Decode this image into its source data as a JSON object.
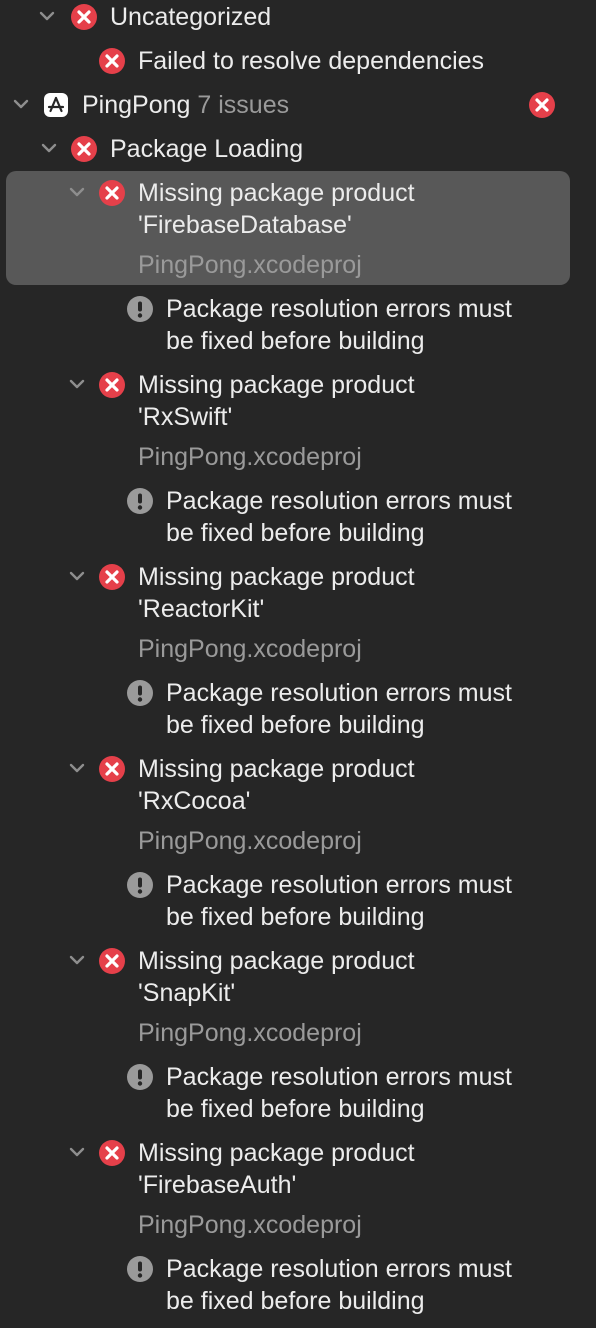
{
  "issues": {
    "uncategorized": {
      "label": "Uncategorized",
      "item": "Failed to resolve dependencies"
    },
    "project": {
      "name": "PingPong",
      "count_label": "7 issues"
    },
    "group": {
      "label": "Package Loading"
    },
    "entries": [
      {
        "line1": "Missing package product",
        "line2": "'FirebaseDatabase'",
        "file": "PingPong.xcodeproj",
        "note1": "Package resolution errors must",
        "note2": "be fixed before building"
      },
      {
        "line1": "Missing package product",
        "line2": "'RxSwift'",
        "file": "PingPong.xcodeproj",
        "note1": "Package resolution errors must",
        "note2": "be fixed before building"
      },
      {
        "line1": "Missing package product",
        "line2": "'ReactorKit'",
        "file": "PingPong.xcodeproj",
        "note1": "Package resolution errors must",
        "note2": "be fixed before building"
      },
      {
        "line1": "Missing package product",
        "line2": "'RxCocoa'",
        "file": "PingPong.xcodeproj",
        "note1": "Package resolution errors must",
        "note2": "be fixed before building"
      },
      {
        "line1": "Missing package product",
        "line2": "'SnapKit'",
        "file": "PingPong.xcodeproj",
        "note1": "Package resolution errors must",
        "note2": "be fixed before building"
      },
      {
        "line1": "Missing package product",
        "line2": "'FirebaseAuth'",
        "file": "PingPong.xcodeproj",
        "note1": "Package resolution errors must",
        "note2": "be fixed before building"
      }
    ]
  },
  "icons": {
    "error": "error-x-icon",
    "warning": "exclamation-icon",
    "disclosure": "chevron-down-icon",
    "project": "app-store-icon"
  },
  "colors": {
    "background": "#262626",
    "selection": "#585858",
    "error": "#e5404a",
    "warning": "#9a9a9a",
    "text": "#ececec",
    "secondary_text": "#9a9a9a"
  }
}
